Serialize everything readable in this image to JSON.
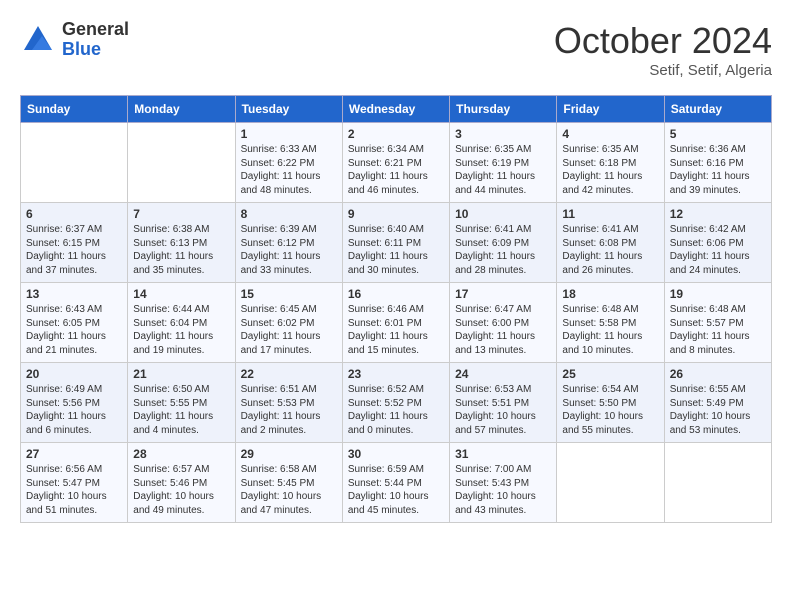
{
  "logo": {
    "general": "General",
    "blue": "Blue"
  },
  "title": "October 2024",
  "subtitle": "Setif, Setif, Algeria",
  "days_of_week": [
    "Sunday",
    "Monday",
    "Tuesday",
    "Wednesday",
    "Thursday",
    "Friday",
    "Saturday"
  ],
  "weeks": [
    [
      {
        "day": "",
        "info": ""
      },
      {
        "day": "",
        "info": ""
      },
      {
        "day": "1",
        "info": "Sunrise: 6:33 AM\nSunset: 6:22 PM\nDaylight: 11 hours and 48 minutes."
      },
      {
        "day": "2",
        "info": "Sunrise: 6:34 AM\nSunset: 6:21 PM\nDaylight: 11 hours and 46 minutes."
      },
      {
        "day": "3",
        "info": "Sunrise: 6:35 AM\nSunset: 6:19 PM\nDaylight: 11 hours and 44 minutes."
      },
      {
        "day": "4",
        "info": "Sunrise: 6:35 AM\nSunset: 6:18 PM\nDaylight: 11 hours and 42 minutes."
      },
      {
        "day": "5",
        "info": "Sunrise: 6:36 AM\nSunset: 6:16 PM\nDaylight: 11 hours and 39 minutes."
      }
    ],
    [
      {
        "day": "6",
        "info": "Sunrise: 6:37 AM\nSunset: 6:15 PM\nDaylight: 11 hours and 37 minutes."
      },
      {
        "day": "7",
        "info": "Sunrise: 6:38 AM\nSunset: 6:13 PM\nDaylight: 11 hours and 35 minutes."
      },
      {
        "day": "8",
        "info": "Sunrise: 6:39 AM\nSunset: 6:12 PM\nDaylight: 11 hours and 33 minutes."
      },
      {
        "day": "9",
        "info": "Sunrise: 6:40 AM\nSunset: 6:11 PM\nDaylight: 11 hours and 30 minutes."
      },
      {
        "day": "10",
        "info": "Sunrise: 6:41 AM\nSunset: 6:09 PM\nDaylight: 11 hours and 28 minutes."
      },
      {
        "day": "11",
        "info": "Sunrise: 6:41 AM\nSunset: 6:08 PM\nDaylight: 11 hours and 26 minutes."
      },
      {
        "day": "12",
        "info": "Sunrise: 6:42 AM\nSunset: 6:06 PM\nDaylight: 11 hours and 24 minutes."
      }
    ],
    [
      {
        "day": "13",
        "info": "Sunrise: 6:43 AM\nSunset: 6:05 PM\nDaylight: 11 hours and 21 minutes."
      },
      {
        "day": "14",
        "info": "Sunrise: 6:44 AM\nSunset: 6:04 PM\nDaylight: 11 hours and 19 minutes."
      },
      {
        "day": "15",
        "info": "Sunrise: 6:45 AM\nSunset: 6:02 PM\nDaylight: 11 hours and 17 minutes."
      },
      {
        "day": "16",
        "info": "Sunrise: 6:46 AM\nSunset: 6:01 PM\nDaylight: 11 hours and 15 minutes."
      },
      {
        "day": "17",
        "info": "Sunrise: 6:47 AM\nSunset: 6:00 PM\nDaylight: 11 hours and 13 minutes."
      },
      {
        "day": "18",
        "info": "Sunrise: 6:48 AM\nSunset: 5:58 PM\nDaylight: 11 hours and 10 minutes."
      },
      {
        "day": "19",
        "info": "Sunrise: 6:48 AM\nSunset: 5:57 PM\nDaylight: 11 hours and 8 minutes."
      }
    ],
    [
      {
        "day": "20",
        "info": "Sunrise: 6:49 AM\nSunset: 5:56 PM\nDaylight: 11 hours and 6 minutes."
      },
      {
        "day": "21",
        "info": "Sunrise: 6:50 AM\nSunset: 5:55 PM\nDaylight: 11 hours and 4 minutes."
      },
      {
        "day": "22",
        "info": "Sunrise: 6:51 AM\nSunset: 5:53 PM\nDaylight: 11 hours and 2 minutes."
      },
      {
        "day": "23",
        "info": "Sunrise: 6:52 AM\nSunset: 5:52 PM\nDaylight: 11 hours and 0 minutes."
      },
      {
        "day": "24",
        "info": "Sunrise: 6:53 AM\nSunset: 5:51 PM\nDaylight: 10 hours and 57 minutes."
      },
      {
        "day": "25",
        "info": "Sunrise: 6:54 AM\nSunset: 5:50 PM\nDaylight: 10 hours and 55 minutes."
      },
      {
        "day": "26",
        "info": "Sunrise: 6:55 AM\nSunset: 5:49 PM\nDaylight: 10 hours and 53 minutes."
      }
    ],
    [
      {
        "day": "27",
        "info": "Sunrise: 6:56 AM\nSunset: 5:47 PM\nDaylight: 10 hours and 51 minutes."
      },
      {
        "day": "28",
        "info": "Sunrise: 6:57 AM\nSunset: 5:46 PM\nDaylight: 10 hours and 49 minutes."
      },
      {
        "day": "29",
        "info": "Sunrise: 6:58 AM\nSunset: 5:45 PM\nDaylight: 10 hours and 47 minutes."
      },
      {
        "day": "30",
        "info": "Sunrise: 6:59 AM\nSunset: 5:44 PM\nDaylight: 10 hours and 45 minutes."
      },
      {
        "day": "31",
        "info": "Sunrise: 7:00 AM\nSunset: 5:43 PM\nDaylight: 10 hours and 43 minutes."
      },
      {
        "day": "",
        "info": ""
      },
      {
        "day": "",
        "info": ""
      }
    ]
  ]
}
